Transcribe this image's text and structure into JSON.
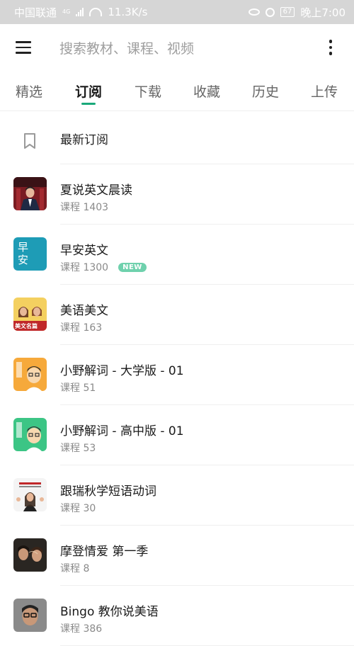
{
  "status_bar": {
    "carrier": "中国联通",
    "signal_text": "4G",
    "speed": "11.3K/s",
    "battery": "67",
    "time": "晚上7:00"
  },
  "app_bar": {
    "search_placeholder": "搜索教材、课程、视频"
  },
  "tabs": [
    {
      "label": "精选",
      "active": false
    },
    {
      "label": "订阅",
      "active": true
    },
    {
      "label": "下载",
      "active": false
    },
    {
      "label": "收藏",
      "active": false
    },
    {
      "label": "历史",
      "active": false
    },
    {
      "label": "上传",
      "active": false
    }
  ],
  "latest": {
    "label": "最新订阅"
  },
  "courses": [
    {
      "title": "夏说英文晨读",
      "subtitle": "课程 1403",
      "badge": ""
    },
    {
      "title": "早安英文",
      "subtitle": "课程 1300",
      "badge": "NEW",
      "cover_text": "早安"
    },
    {
      "title": "美语美文",
      "subtitle": "课程 163",
      "badge": "",
      "cover_text": "美文名篇"
    },
    {
      "title": "小野解词 - 大学版 - 01",
      "subtitle": "课程 51",
      "badge": ""
    },
    {
      "title": "小野解词 - 高中版 - 01",
      "subtitle": "课程 53",
      "badge": ""
    },
    {
      "title": "跟瑞秋学短语动词",
      "subtitle": "课程 30",
      "badge": ""
    },
    {
      "title": "摩登情爱 第一季",
      "subtitle": "课程 8",
      "badge": ""
    },
    {
      "title": "Bingo 教你说美语",
      "subtitle": "课程 386",
      "badge": ""
    }
  ],
  "colors": {
    "accent": "#1aa97a",
    "badge": "#6fd1ad",
    "status_bar": "#d6d6d6"
  }
}
